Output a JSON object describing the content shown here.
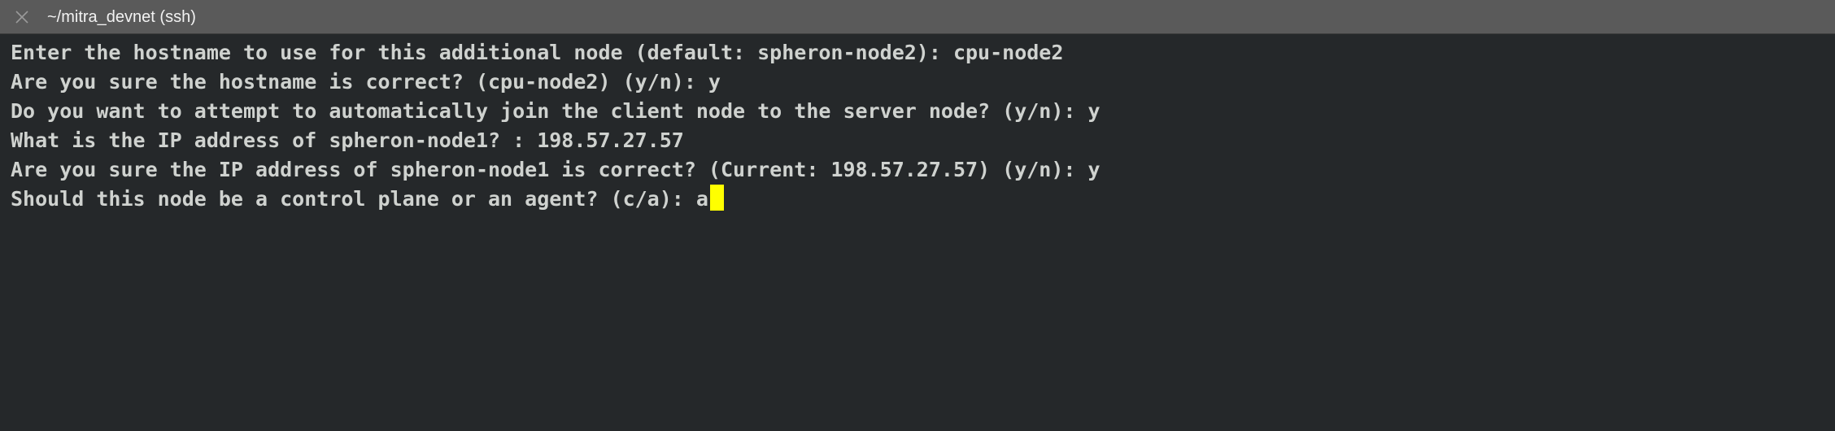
{
  "window": {
    "title": "~/mitra_devnet (ssh)",
    "close_icon": "close-icon"
  },
  "terminal": {
    "lines": [
      "Enter the hostname to use for this additional node (default: spheron-node2): cpu-node2",
      "Are you sure the hostname is correct? (cpu-node2) (y/n): y",
      "Do you want to attempt to automatically join the client node to the server node? (y/n): y",
      "What is the IP address of spheron-node1? : 198.57.27.57",
      "Are you sure the IP address of spheron-node1 is correct? (Current: 198.57.27.57) (y/n): y",
      "Should this node be a control plane or an agent? (c/a): a"
    ],
    "cursor_color": "#ffff00",
    "text_color": "#cfd2cf",
    "background_color": "#25282a"
  }
}
